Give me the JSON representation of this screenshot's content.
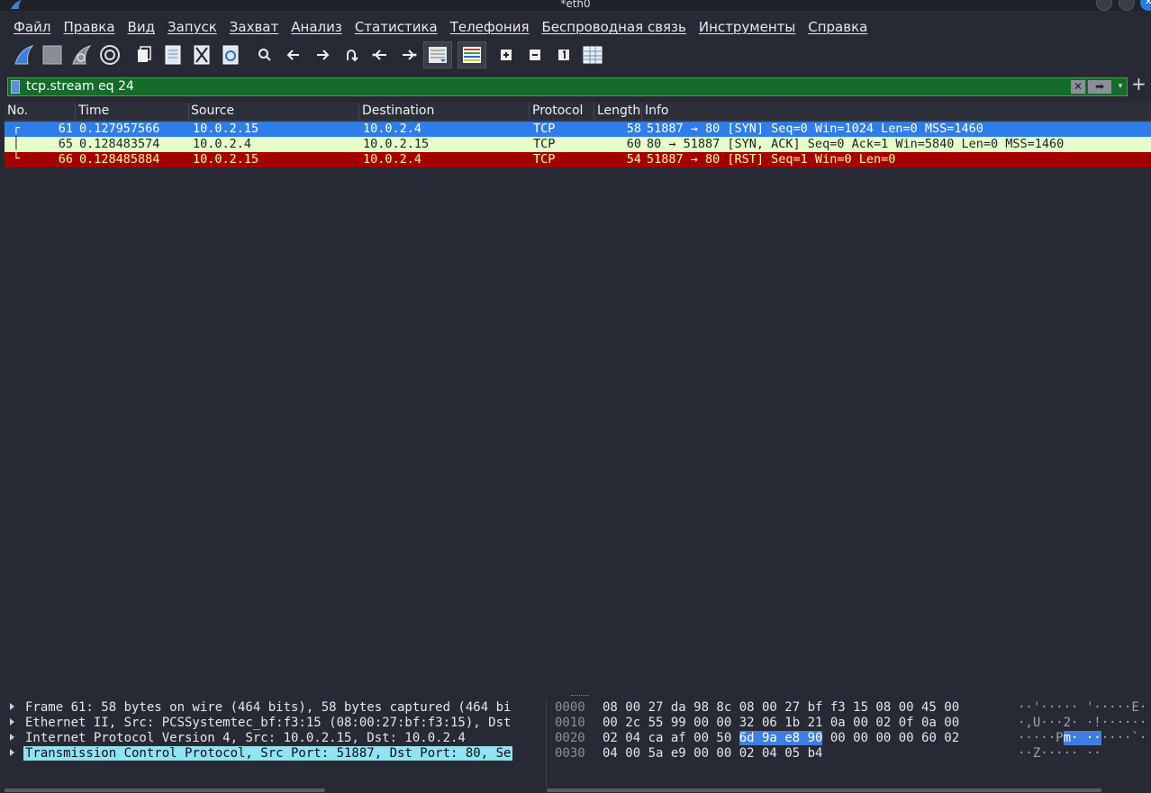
{
  "window": {
    "title": "*eth0"
  },
  "menu": [
    "Файл",
    "Правка",
    "Вид",
    "Запуск",
    "Захват",
    "Анализ",
    "Статистика",
    "Телефония",
    "Беспроводная связь",
    "Инструменты",
    "Справка"
  ],
  "toolbar": {
    "icons": [
      "shark-fin-start-icon",
      "stop-square-icon",
      "restart-fin-icon",
      "gear-options-icon",
      "open-file-icon",
      "save-file-icon",
      "close-file-icon",
      "reload-file-icon",
      "search-icon",
      "go-back-icon",
      "go-forward-icon",
      "go-to-packet-icon",
      "first-packet-icon",
      "last-packet-icon",
      "autoscroll-icon",
      "colorize-icon",
      "zoom-in-icon",
      "zoom-out-icon",
      "normal-size-icon",
      "resize-columns-icon"
    ]
  },
  "filter": {
    "value": "tcp.stream eq 24",
    "clear": "✕",
    "apply": "➡",
    "dropdown": "▾",
    "add": "+"
  },
  "columns": {
    "no": "No.",
    "time": "Time",
    "source": "Source",
    "destination": "Destination",
    "protocol": "Protocol",
    "length": "Length",
    "info": "Info"
  },
  "packets": [
    {
      "no": "61",
      "time": "0.127957566",
      "source": "10.0.2.15",
      "destination": "10.0.2.4",
      "protocol": "TCP",
      "length": "58",
      "info": "51887 → 80 [SYN] Seq=0 Win=1024 Len=0 MSS=1460",
      "bg": "#2f7de8",
      "fg": "#ffffff",
      "tree": "┌"
    },
    {
      "no": "65",
      "time": "0.128483574",
      "source": "10.0.2.4",
      "destination": "10.0.2.15",
      "protocol": "TCP",
      "length": "60",
      "info": "80 → 51887 [SYN, ACK] Seq=0 Ack=1 Win=5840 Len=0 MSS=1460",
      "bg": "#e4ffc7",
      "fg": "#12272e",
      "tree": "│"
    },
    {
      "no": "66",
      "time": "0.128485884",
      "source": "10.0.2.15",
      "destination": "10.0.2.4",
      "protocol": "TCP",
      "length": "54",
      "info": "51887 → 80 [RST] Seq=1 Win=0 Len=0",
      "bg": "#a40000",
      "fg": "#fffc9c",
      "tree": "└"
    }
  ],
  "details": [
    "Frame 61: 58 bytes on wire (464 bits), 58 bytes captured (464 bi",
    "Ethernet II, Src: PCSSystemtec_bf:f3:15 (08:00:27:bf:f3:15), Dst",
    "Internet Protocol Version 4, Src: 10.0.2.15, Dst: 10.0.2.4",
    "Transmission Control Protocol, Src Port: 51887, Dst Port: 80, Se"
  ],
  "bytes": [
    {
      "offset": "0000",
      "hex_pre": "08 00 27 da 98 8c 08 00  27 bf f3 15 08 00 45 00",
      "hex_hl": "",
      "hex_post": "",
      "ascii_pre": "··'····· '·····E·",
      "ascii_hl": "",
      "ascii_post": ""
    },
    {
      "offset": "0010",
      "hex_pre": "00 2c 55 99 00 00 32 06  1b 21 0a 00 02 0f 0a 00",
      "hex_hl": "",
      "hex_post": "",
      "ascii_pre": "·,U···2· ·!······",
      "ascii_hl": "",
      "ascii_post": ""
    },
    {
      "offset": "0020",
      "hex_pre": "02 04 ca af 00 50 ",
      "hex_hl": "6d 9a  e8 90",
      "hex_post": " 00 00 00 00 60 02",
      "ascii_pre": "·····P",
      "ascii_hl": "m· ··",
      "ascii_post": "····`·"
    },
    {
      "offset": "0030",
      "hex_pre": "04 00 5a e9 00 00 02 04  05 b4",
      "hex_hl": "",
      "hex_post": "",
      "ascii_pre": "··Z····· ··",
      "ascii_hl": "",
      "ascii_post": ""
    }
  ]
}
